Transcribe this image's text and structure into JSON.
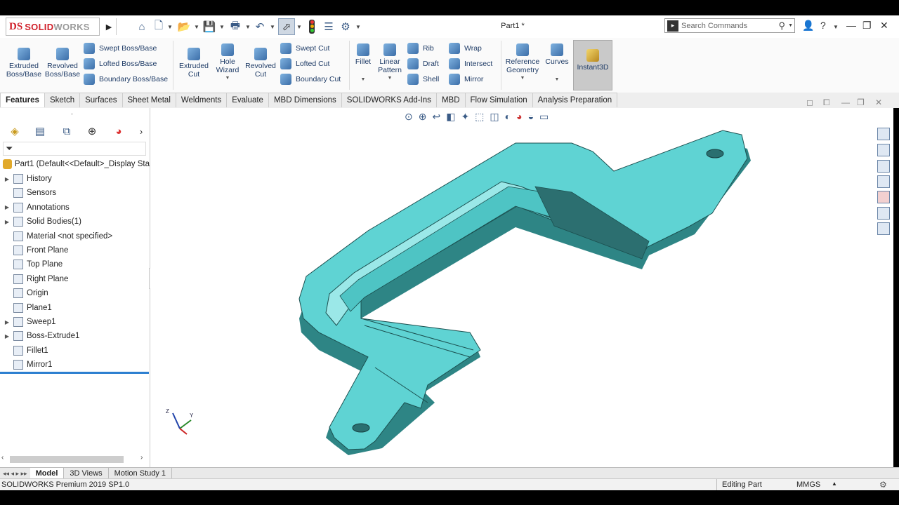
{
  "titlebar": {
    "brand_prefix": "DS",
    "brand_name_red": "SOLID",
    "brand_name_gray": "WORKS",
    "document_title": "Part1 *",
    "search_placeholder": "Search Commands",
    "help_label": "?"
  },
  "command_manager": {
    "extruded_boss": [
      "Extruded",
      "Boss/Base"
    ],
    "revolved_boss": [
      "Revolved",
      "Boss/Base"
    ],
    "swept_boss": "Swept Boss/Base",
    "lofted_boss": "Lofted Boss/Base",
    "boundary_boss": "Boundary Boss/Base",
    "extruded_cut": [
      "Extruded",
      "Cut"
    ],
    "hole_wizard": [
      "Hole",
      "Wizard"
    ],
    "revolved_cut": [
      "Revolved",
      "Cut"
    ],
    "swept_cut": "Swept Cut",
    "lofted_cut": "Lofted Cut",
    "boundary_cut": "Boundary Cut",
    "fillet": "Fillet",
    "linear_pattern": [
      "Linear",
      "Pattern"
    ],
    "rib": "Rib",
    "draft": "Draft",
    "shell": "Shell",
    "wrap": "Wrap",
    "intersect": "Intersect",
    "mirror": "Mirror",
    "reference_geometry": [
      "Reference",
      "Geometry"
    ],
    "curves": "Curves",
    "instant3d": "Instant3D"
  },
  "tabs": [
    "Features",
    "Sketch",
    "Surfaces",
    "Sheet Metal",
    "Weldments",
    "Evaluate",
    "MBD Dimensions",
    "SOLIDWORKS Add-Ins",
    "MBD",
    "Flow Simulation",
    "Analysis Preparation"
  ],
  "feature_tree": {
    "root": "Part1  (Default<<Default>_Display Sta",
    "items": [
      {
        "label": "History",
        "expandable": true,
        "icon": "history-icon"
      },
      {
        "label": "Sensors",
        "expandable": false,
        "icon": "sensors-icon"
      },
      {
        "label": "Annotations",
        "expandable": true,
        "icon": "annotations-icon"
      },
      {
        "label": "Solid Bodies(1)",
        "expandable": true,
        "icon": "solid-bodies-icon"
      },
      {
        "label": "Material <not specified>",
        "expandable": false,
        "icon": "material-icon"
      },
      {
        "label": "Front Plane",
        "expandable": false,
        "icon": "plane-icon"
      },
      {
        "label": "Top Plane",
        "expandable": false,
        "icon": "plane-icon"
      },
      {
        "label": "Right Plane",
        "expandable": false,
        "icon": "plane-icon"
      },
      {
        "label": "Origin",
        "expandable": false,
        "icon": "origin-icon"
      },
      {
        "label": "Plane1",
        "expandable": false,
        "icon": "plane-icon"
      },
      {
        "label": "Sweep1",
        "expandable": true,
        "icon": "sweep-icon"
      },
      {
        "label": "Boss-Extrude1",
        "expandable": true,
        "icon": "extrude-icon"
      },
      {
        "label": "Fillet1",
        "expandable": false,
        "icon": "fillet-icon"
      },
      {
        "label": "Mirror1",
        "expandable": false,
        "icon": "mirror-icon"
      }
    ]
  },
  "triad": {
    "x": "Y",
    "z": "Z"
  },
  "bottom_tabs": [
    "Model",
    "3D Views",
    "Motion Study 1"
  ],
  "status": {
    "version": "SOLIDWORKS Premium 2019 SP1.0",
    "mode": "Editing Part",
    "units": "MMGS"
  },
  "colors": {
    "part": "#5fd3d3",
    "part_dark": "#2e7f7f",
    "accent_red": "#d0202a",
    "selection_blue": "#2d7fd0"
  }
}
